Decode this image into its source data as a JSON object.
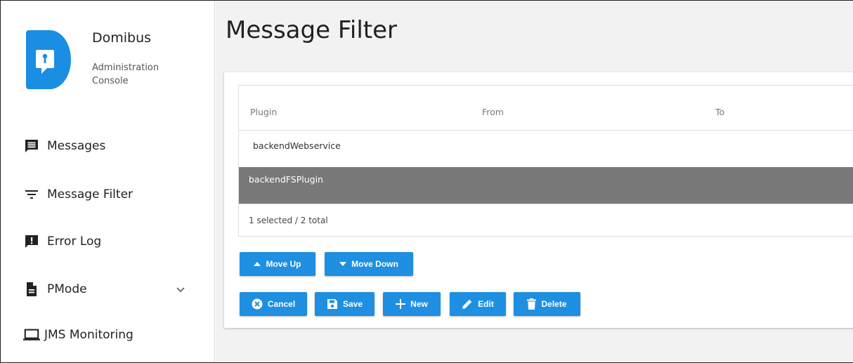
{
  "app": {
    "name": "Domibus",
    "subtitle": "Administration Console"
  },
  "sidebar": {
    "items": [
      {
        "label": "Messages",
        "icon": "messages-icon"
      },
      {
        "label": "Message Filter",
        "icon": "filter-icon"
      },
      {
        "label": "Error Log",
        "icon": "error-log-icon"
      },
      {
        "label": "PMode",
        "icon": "document-icon",
        "expand_icon": "chevron-down-icon"
      },
      {
        "label": "JMS Monitoring",
        "icon": "monitor-icon"
      }
    ]
  },
  "main": {
    "title": "Message Filter",
    "table": {
      "columns": [
        "Plugin",
        "From",
        "To"
      ],
      "rows": [
        {
          "plugin": "backendWebservice",
          "from": "",
          "to": "",
          "selected": false
        },
        {
          "plugin": "backendFSPlugin",
          "from": "",
          "to": "",
          "selected": true
        }
      ],
      "footer": "1 selected / 2 total"
    },
    "buttons": {
      "move_up": "Move Up",
      "move_down": "Move Down",
      "cancel": "Cancel",
      "save": "Save",
      "new": "New",
      "edit": "Edit",
      "delete": "Delete"
    }
  },
  "colors": {
    "accent": "#1e8fe1",
    "logo_blue": "#1a8ee2",
    "selected_row": "#787878"
  }
}
